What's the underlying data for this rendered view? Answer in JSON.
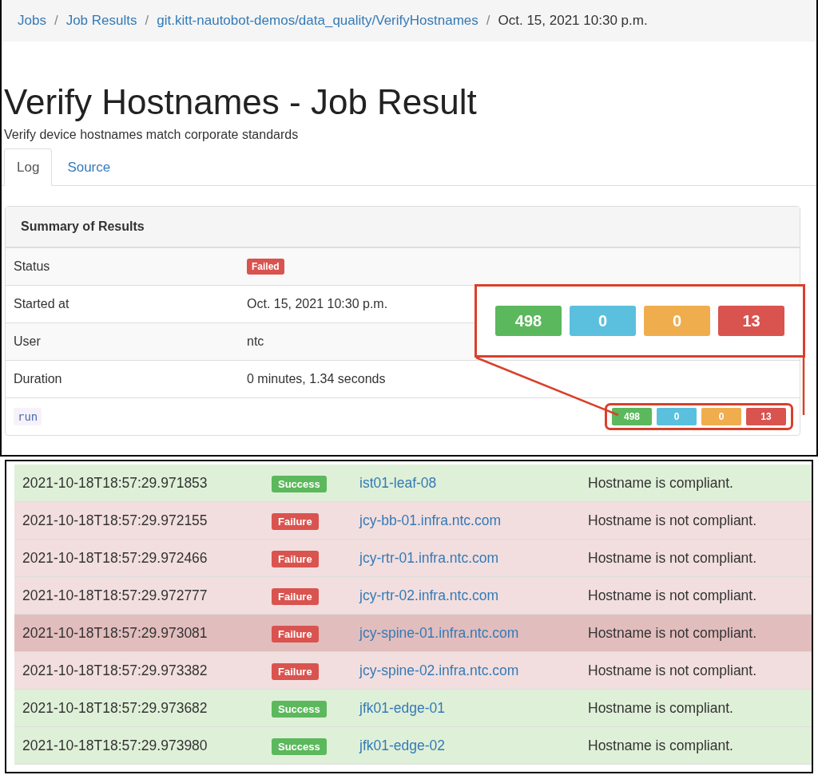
{
  "breadcrumb": [
    {
      "label": "Jobs",
      "link": true
    },
    {
      "separator": "/",
      "label": "Job Results",
      "link": true
    },
    {
      "separator": "/",
      "label": "git.kitt-nautobot-demos/data_quality/VerifyHostnames",
      "link": true
    },
    {
      "separator": "/",
      "label": "Oct. 15, 2021 10:30 p.m.",
      "link": false
    }
  ],
  "title": "Verify Hostnames - Job Result",
  "description": "Verify device hostnames match corporate standards",
  "tabs": [
    {
      "label": "Log",
      "selected": true
    },
    {
      "label": "Source",
      "selected": false
    }
  ],
  "summary": {
    "heading": "Summary of Results",
    "rows": [
      {
        "label": "Status",
        "value": "Failed",
        "kind": "badge"
      },
      {
        "label": "Started at",
        "value": "Oct. 15, 2021 10:30 p.m.",
        "kind": "text"
      },
      {
        "label": "User",
        "value": "ntc",
        "kind": "text"
      },
      {
        "label": "Duration",
        "value": "0 minutes, 1.34 seconds",
        "kind": "text"
      }
    ],
    "run": {
      "label": "run",
      "counts": [
        {
          "value": "498",
          "color": "#5cb85c"
        },
        {
          "value": "0",
          "color": "#5bc0de"
        },
        {
          "value": "0",
          "color": "#f0ad4e"
        },
        {
          "value": "13",
          "color": "#d9534f"
        }
      ]
    }
  },
  "callout": {
    "counts": [
      {
        "value": "498",
        "color": "#5cb85c"
      },
      {
        "value": "0",
        "color": "#5bc0de"
      },
      {
        "value": "0",
        "color": "#f0ad4e"
      },
      {
        "value": "13",
        "color": "#d9534f"
      }
    ]
  },
  "log": [
    {
      "time": "2021-10-18T18:57:29.971853",
      "status": "Success",
      "kind": "success",
      "object": "ist01-leaf-08",
      "message": "Hostname is compliant.",
      "selected": false
    },
    {
      "time": "2021-10-18T18:57:29.972155",
      "status": "Failure",
      "kind": "failure",
      "object": "jcy-bb-01.infra.ntc.com",
      "message": "Hostname is not compliant.",
      "selected": false
    },
    {
      "time": "2021-10-18T18:57:29.972466",
      "status": "Failure",
      "kind": "failure",
      "object": "jcy-rtr-01.infra.ntc.com",
      "message": "Hostname is not compliant.",
      "selected": false
    },
    {
      "time": "2021-10-18T18:57:29.972777",
      "status": "Failure",
      "kind": "failure",
      "object": "jcy-rtr-02.infra.ntc.com",
      "message": "Hostname is not compliant.",
      "selected": false
    },
    {
      "time": "2021-10-18T18:57:29.973081",
      "status": "Failure",
      "kind": "failure",
      "object": "jcy-spine-01.infra.ntc.com",
      "message": "Hostname is not compliant.",
      "selected": true
    },
    {
      "time": "2021-10-18T18:57:29.973382",
      "status": "Failure",
      "kind": "failure",
      "object": "jcy-spine-02.infra.ntc.com",
      "message": "Hostname is not compliant.",
      "selected": false
    },
    {
      "time": "2021-10-18T18:57:29.973682",
      "status": "Success",
      "kind": "success",
      "object": "jfk01-edge-01",
      "message": "Hostname is compliant.",
      "selected": false
    },
    {
      "time": "2021-10-18T18:57:29.973980",
      "status": "Success",
      "kind": "success",
      "object": "jfk01-edge-02",
      "message": "Hostname is compliant.",
      "selected": false
    }
  ]
}
